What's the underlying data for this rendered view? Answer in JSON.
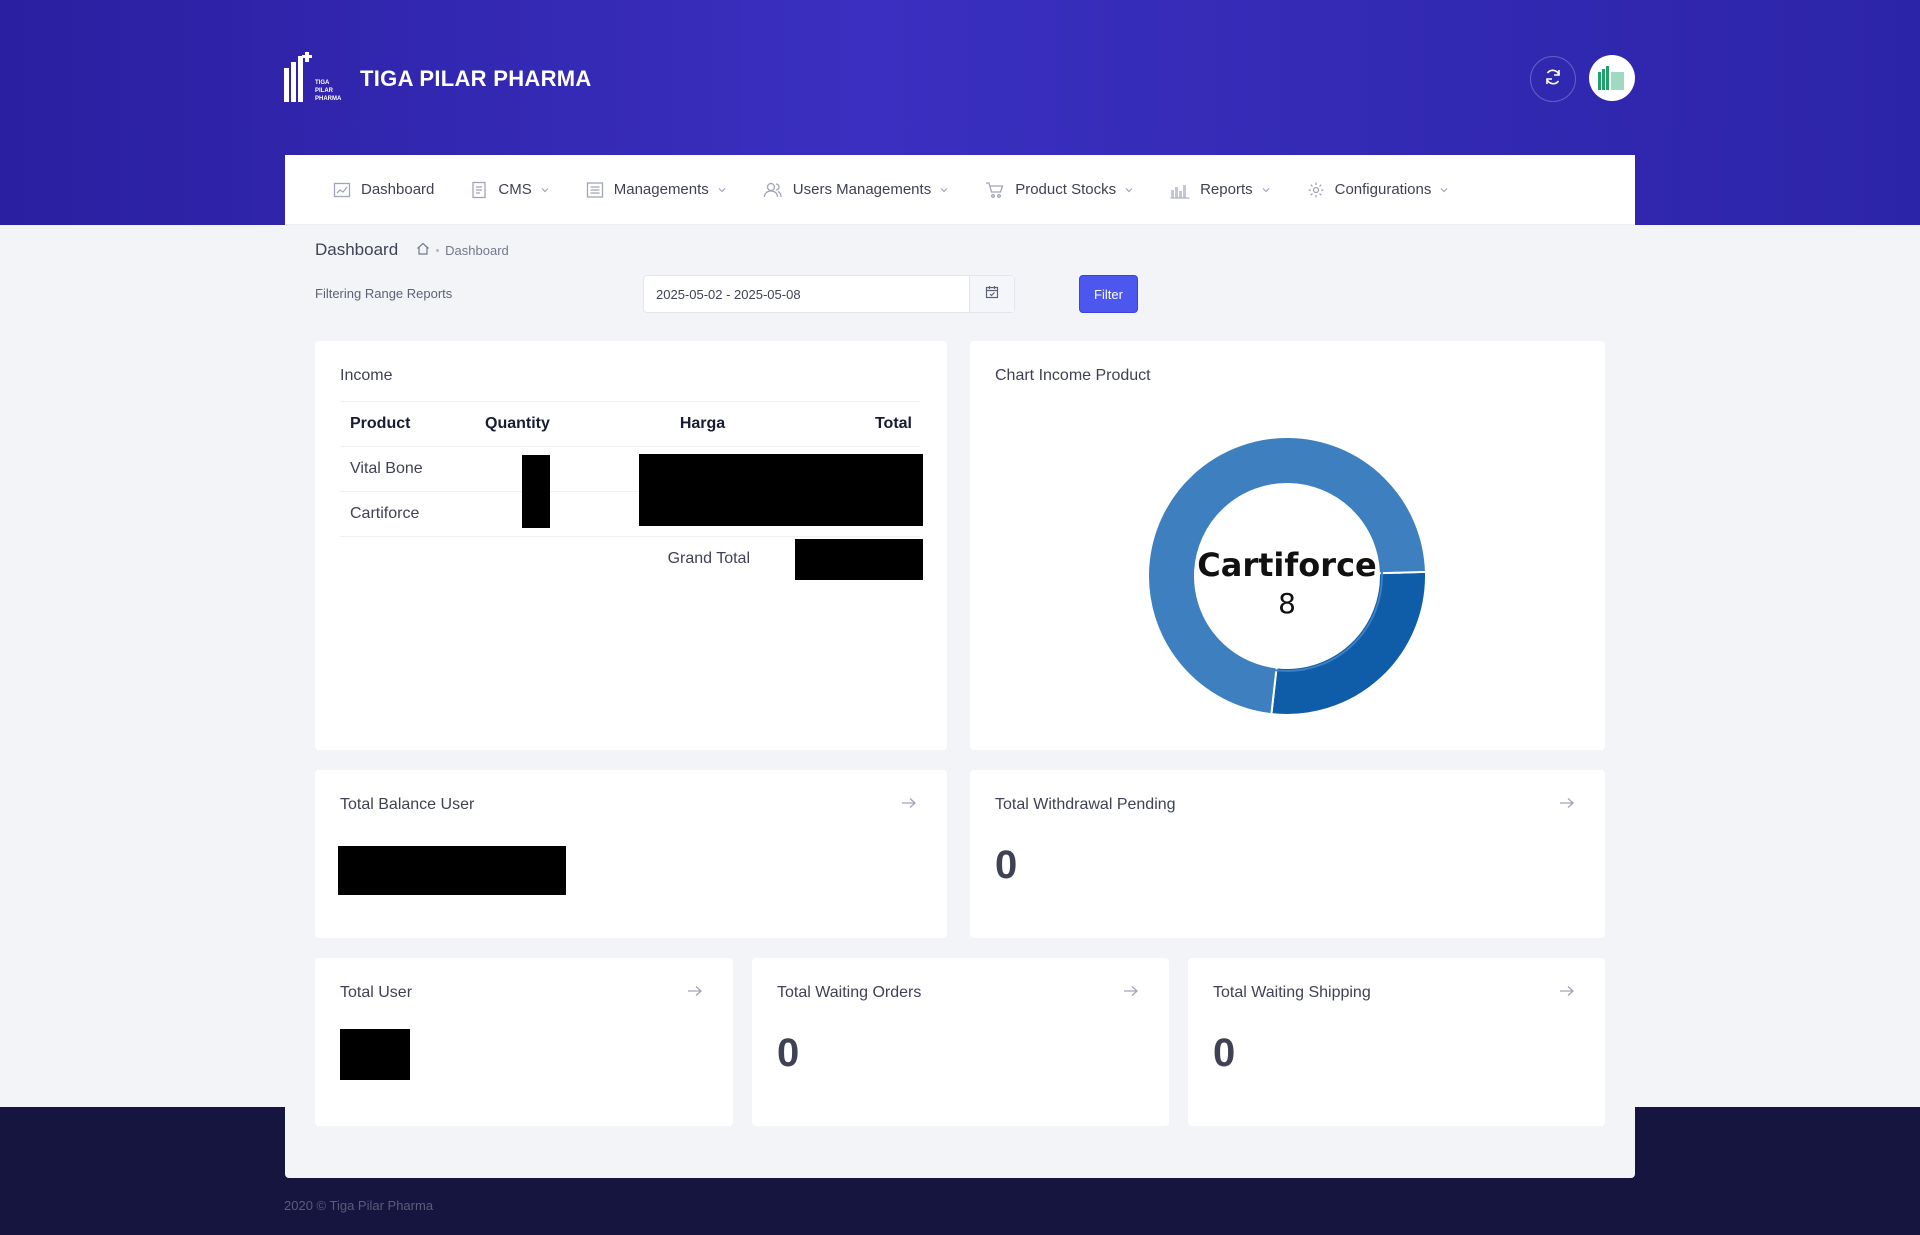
{
  "header": {
    "brand_name": "TIGA PILAR PHARMA",
    "brand_logo_text": [
      "TIGA",
      "PILAR",
      "PHARMA"
    ]
  },
  "nav": {
    "items": [
      {
        "label": "Dashboard",
        "icon": "chart-icon"
      },
      {
        "label": "CMS",
        "icon": "document-icon"
      },
      {
        "label": "Managements",
        "icon": "list-icon"
      },
      {
        "label": "Users Managements",
        "icon": "users-icon"
      },
      {
        "label": "Product Stocks",
        "icon": "cart-icon"
      },
      {
        "label": "Reports",
        "icon": "bar-chart-icon"
      },
      {
        "label": "Configurations",
        "icon": "gear-icon"
      }
    ]
  },
  "subheader": {
    "title": "Dashboard",
    "breadcrumb": "Dashboard"
  },
  "filter": {
    "label": "Filtering Range Reports",
    "date_range": "2025-05-02 - 2025-05-08",
    "button": "Filter"
  },
  "income": {
    "title": "Income",
    "columns": [
      "Product",
      "Quantity",
      "Harga",
      "Total"
    ],
    "rows": [
      {
        "product": "Vital Bone"
      },
      {
        "product": "Cartiforce"
      }
    ],
    "grand_total_label": "Grand Total"
  },
  "chart": {
    "title": "Chart Income Product",
    "center_label": "Cartiforce",
    "center_value": "8",
    "colors": {
      "primary": "#3d7fbf",
      "secondary": "#0f5da8"
    }
  },
  "chart_data": {
    "type": "pie",
    "categories": [
      "Cartiforce",
      "Vital Bone"
    ],
    "values": [
      8,
      3
    ],
    "colors": [
      "#3d7fbf",
      "#0f5da8"
    ]
  },
  "stats": {
    "total_balance_user": {
      "title": "Total Balance User"
    },
    "total_withdrawal_pending": {
      "title": "Total Withdrawal Pending",
      "value": "0"
    },
    "total_user": {
      "title": "Total User"
    },
    "total_waiting_orders": {
      "title": "Total Waiting Orders",
      "value": "0"
    },
    "total_waiting_shipping": {
      "title": "Total Waiting Shipping",
      "value": "0"
    }
  },
  "footer": {
    "copyright": "2020 © Tiga Pilar Pharma"
  }
}
